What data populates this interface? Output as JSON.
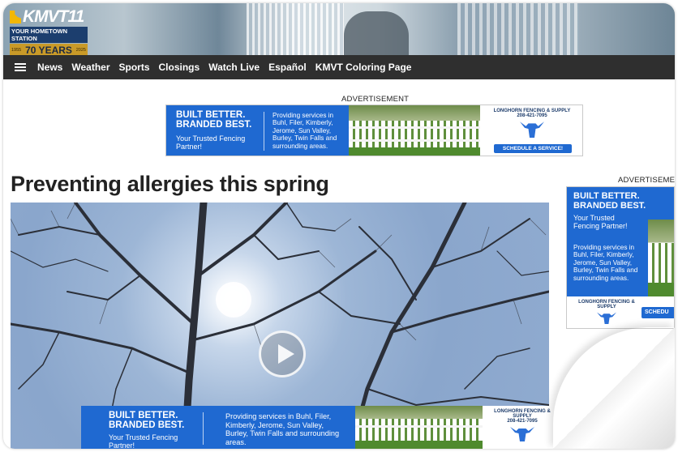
{
  "header": {
    "logo_text": "KMVT11",
    "logo_subtitle": "YOUR HOMETOWN STATION",
    "logo_years": "70 YEARS",
    "logo_year_start": "1955",
    "logo_year_end": "2025"
  },
  "nav": {
    "menu_icon": "hamburger-icon",
    "items": [
      {
        "label": "News"
      },
      {
        "label": "Weather"
      },
      {
        "label": "Sports"
      },
      {
        "label": "Closings"
      },
      {
        "label": "Watch Live"
      },
      {
        "label": "Español"
      },
      {
        "label": "KMVT Coloring Page"
      }
    ]
  },
  "ad_label": "ADVERTISEMENT",
  "sidebar_ad_label": "ADVERTISEME",
  "ad": {
    "headline_1": "BUILT BETTER.",
    "headline_2": "BRANDED BEST.",
    "tagline": "Your Trusted Fencing Partner!",
    "services": "Providing services in Buhl, Filer, Kimberly, Jerome, Sun Valley, Burley, Twin Falls and surrounding areas.",
    "brand": "LONGHORN FENCING & SUPPLY",
    "phone": "208-421-7095",
    "cta": "SCHEDULE A SERVICE!",
    "sidebar_cta": "SCHEDU"
  },
  "article": {
    "title": "Preventing allergies this spring"
  },
  "video": {
    "play_icon": "play-icon"
  },
  "colors": {
    "nav_bg": "#2f2f2f",
    "ad_blue": "#1f69d1",
    "title": "#222222"
  }
}
